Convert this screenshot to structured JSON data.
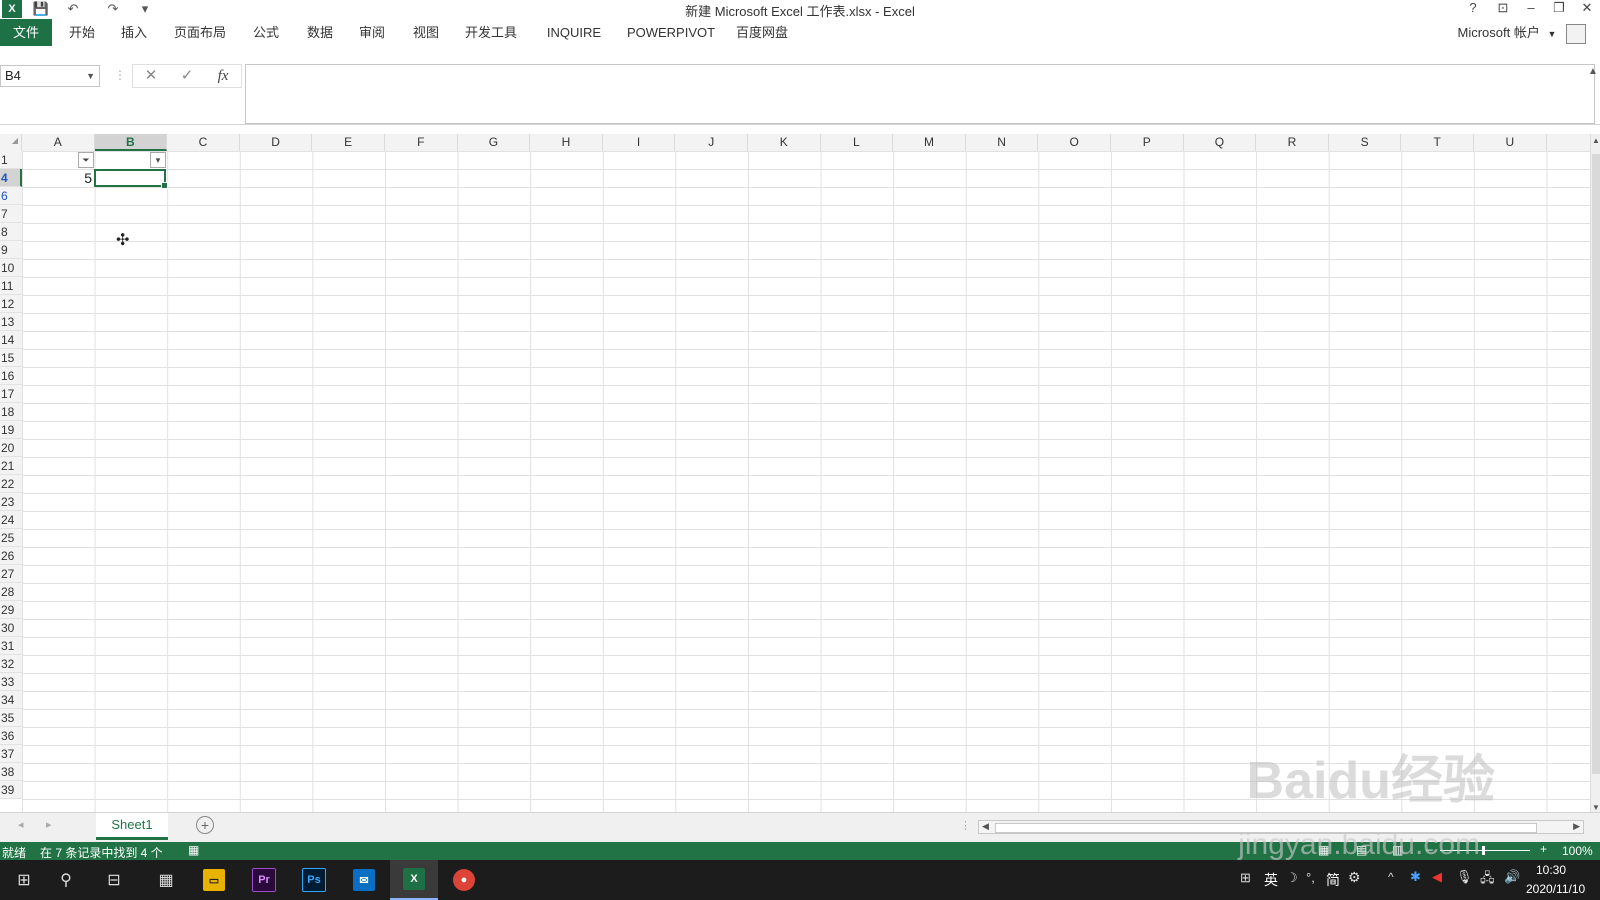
{
  "window": {
    "title": "新建 Microsoft Excel 工作表.xlsx - Excel",
    "help": "?",
    "minimize": "–",
    "restore": "❐",
    "close": "✕"
  },
  "quick_access": {
    "app_icon": "X",
    "save": "💾",
    "undo": "↶",
    "redo": "↷",
    "customize": "▾"
  },
  "ribbon": {
    "tabs": [
      "文件",
      "开始",
      "插入",
      "页面布局",
      "公式",
      "数据",
      "审阅",
      "视图",
      "开发工具",
      "INQUIRE",
      "POWERPIVOT",
      "百度网盘"
    ],
    "account": "Microsoft 帐户"
  },
  "formula_bar": {
    "name_box": "B4",
    "cancel": "✕",
    "enter": "✓",
    "fx": "fx",
    "formula": ""
  },
  "columns": [
    "A",
    "B",
    "C",
    "D",
    "E",
    "F",
    "G",
    "H",
    "I",
    "J",
    "K",
    "L",
    "M",
    "N",
    "O",
    "P",
    "Q",
    "R",
    "S",
    "T",
    "U"
  ],
  "active_column": "B",
  "rows": [
    "1",
    "4",
    "6",
    "7",
    "8",
    "9",
    "10",
    "11",
    "12",
    "13",
    "14",
    "15",
    "16",
    "17",
    "18",
    "19",
    "20",
    "21",
    "22",
    "23",
    "24",
    "25",
    "26",
    "27",
    "28",
    "29",
    "30",
    "31",
    "32",
    "33",
    "34",
    "35",
    "36",
    "37",
    "38",
    "39"
  ],
  "active_row": "4",
  "cells": {
    "A4": "5"
  },
  "sheets": [
    "Sheet1"
  ],
  "status": {
    "ready": "就绪",
    "filter_result": "在 7 条记录中找到 4 个",
    "zoom": "100%"
  },
  "taskbar": {
    "ime": "英",
    "lang": "简",
    "time": "10:30",
    "date": "2020/11/10"
  },
  "watermark": {
    "logo": "Baidu经验",
    "url": "jingyan.baidu.com"
  }
}
